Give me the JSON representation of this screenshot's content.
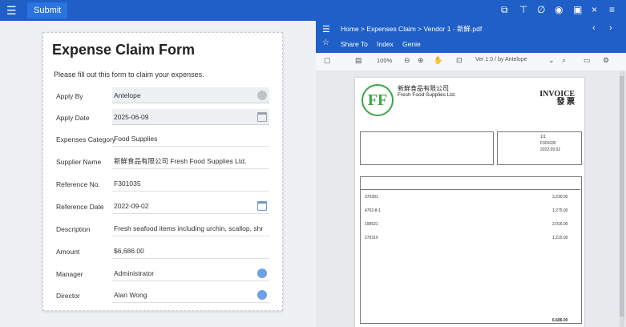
{
  "topbar": {
    "menu_icon": "menu-icon",
    "submit_label": "Submit"
  },
  "form": {
    "title": "Expense Claim Form",
    "intro": "Please fill out this form to claim your expenses.",
    "fields": [
      {
        "label": "Apply By",
        "value": "Antelope",
        "icon": "avatar-icon"
      },
      {
        "label": "Apply Date",
        "value": "2025-06-09",
        "icon": "calendar-icon"
      },
      {
        "label": "Expenses Category",
        "value": "Food Supplies"
      },
      {
        "label": "Supplier Name",
        "value": "新鮮食品有限公司 Fresh Food Supplies Ltd."
      },
      {
        "label": "Reference No.",
        "value": "F301035"
      },
      {
        "label": "Reference Date",
        "value": "2022-09-02",
        "icon": "calendar-icon"
      },
      {
        "label": "Description",
        "value": "Fresh seafood items including urchin, scallop, shr"
      },
      {
        "label": "Amount",
        "value": "$6,686.00"
      },
      {
        "label": "Manager",
        "value": "Administrator",
        "icon": "avatar-icon"
      },
      {
        "label": "Director",
        "value": "Alan Wong",
        "icon": "avatar-icon"
      }
    ]
  },
  "pdf": {
    "breadcrumb": "Home > Expenses Claim > Vendor 1 - 新鮮.pdf",
    "tabs": [
      "Share To",
      "Index",
      "Genie"
    ],
    "zoom": "100%",
    "page_selector": "Ver 1.0 / by Antelope",
    "document": {
      "company_cn": "新鮮食品有限公司",
      "company_en": "Fresh Food Supplies Ltd.",
      "invoice_en": "INVOICE",
      "invoice_cn": "發 票",
      "page_no": "1/1",
      "invoice_no": "F301035",
      "invoice_date": "2022.09.02",
      "total": "6,686.00",
      "line_items": [
        {
          "code": "370281",
          "amount": "3,230.00"
        },
        {
          "code": "4702-8-1",
          "amount": "1,275.00"
        },
        {
          "code": "199521",
          "amount": "2,016.00"
        },
        {
          "code": "270310",
          "amount": "1,215.00"
        }
      ]
    }
  }
}
